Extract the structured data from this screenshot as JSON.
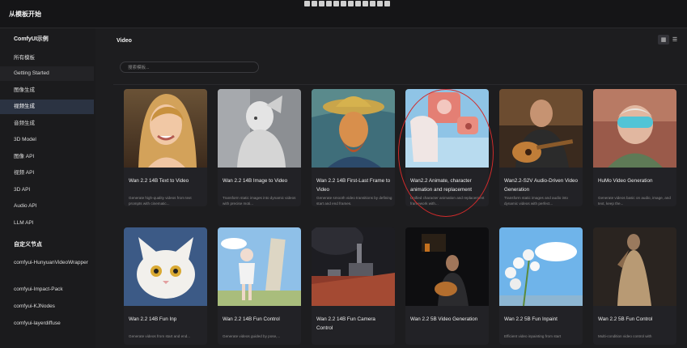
{
  "header": {
    "title": "从模板开始"
  },
  "sidebar": {
    "section1": "ComfyUI示例",
    "items": [
      {
        "label": "所有模板"
      },
      {
        "label": "Getting Started"
      },
      {
        "label": "图像生成"
      },
      {
        "label": "视频生成"
      },
      {
        "label": "音频生成"
      },
      {
        "label": "3D Model"
      },
      {
        "label": "图像 API"
      },
      {
        "label": "视频 API"
      },
      {
        "label": "3D API"
      },
      {
        "label": "Audio API"
      },
      {
        "label": "LLM API"
      }
    ],
    "section2": "自定义节点",
    "custom": [
      {
        "label": "comfyui-HunyuanVideoWrapper"
      },
      {
        "label": "comfyui-Impact-Pack"
      },
      {
        "label": "comfyui-KJNodes"
      },
      {
        "label": "comfyui-layerdiffuse"
      }
    ]
  },
  "main": {
    "title": "Video",
    "search_placeholder": "搜索模板...",
    "view_icons": [
      "grid-icon",
      "list-icon"
    ],
    "cards": [
      {
        "title": "Wan 2.2 14B Text to Video",
        "desc": "Generate high-quality videos from text prompts with cinematic..."
      },
      {
        "title": "Wan 2.2 14B Image to Video",
        "desc": "Transform static images into dynamic videos with precise moti..."
      },
      {
        "title": "Wan 2.2 14B First-Last Frame to Video",
        "desc": "Generate smooth video transitions by defining start and end frames."
      },
      {
        "title": "Wan2.2 Animate, character animation and replacement",
        "desc": "Unified character animation and replacement framework with..."
      },
      {
        "title": "Wan2.2-S2V Audio-Driven Video Generation",
        "desc": "Transform static images and audio into dynamic videos with perfect..."
      },
      {
        "title": "HuMo Video Generation",
        "desc": "Generate videos basic on audio, image, and text, keep the..."
      },
      {
        "title": "Wan 2.2 14B Fun Inp",
        "desc": "Generate videos from start and end..."
      },
      {
        "title": "Wan 2.2 14B Fun Control",
        "desc": "Generate videos guided by pose,..."
      },
      {
        "title": "Wan 2.2 14B Fun Camera Control",
        "desc": ""
      },
      {
        "title": "Wan 2.2 5B Video Generation",
        "desc": ""
      },
      {
        "title": "Wan 2.2 5B Fun Inpaint",
        "desc": "Efficient video inpainting from start"
      },
      {
        "title": "Wan 2.2 5B Fun Control",
        "desc": "Multi-condition video control with"
      }
    ]
  },
  "colors": {
    "accent": "#2b3342",
    "annotation": "#d12b2b"
  }
}
